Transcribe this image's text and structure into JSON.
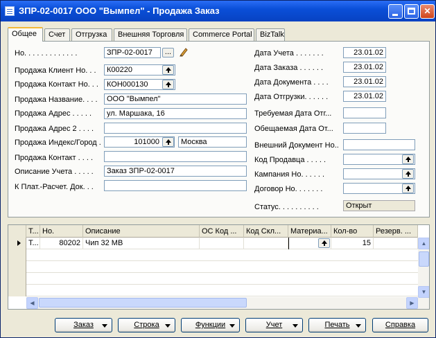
{
  "window": {
    "title": "ЗПР-02-0017 ООО \"Вымпел\" - Продажа Заказ"
  },
  "tabs": [
    "Общее",
    "Счет",
    "Отгрузка",
    "Внешняя Торговля",
    "Commerce Portal",
    "BizTalk"
  ],
  "left": {
    "no_label": "Но. . . . . . . . . . . . .",
    "no_value": "ЗПР-02-0017",
    "no_button": "...",
    "client_label": "Продажа Клиент Но. . .",
    "client_value": "К00220",
    "contact_no_label": "Продажа Контакт Но. . .",
    "contact_no_value": "КОН000130",
    "name_label": "Продажа Название. . . .",
    "name_value": "ООО \"Вымпел\"",
    "address_label": "Продажа Адрес . . . . .",
    "address_value": "ул. Маршака, 16",
    "address2_label": "Продажа Адрес 2 . . . .",
    "address2_value": "",
    "postcode_label": "Продажа Индекс/Город .",
    "postcode_value": "101000",
    "city_value": "Москва",
    "contact_label": "Продажа Контакт . . . .",
    "contact_value": "",
    "posting_desc_label": "Описание Учета . . . . .",
    "posting_desc_value": "Заказ ЗПР-02-0017",
    "payment_label": "К Плат.-Расчет. Док. . .",
    "payment_value": ""
  },
  "right": {
    "posting_date_label": "Дата Учета . . . . . . .",
    "posting_date_value": "23.01.02",
    "order_date_label": "Дата Заказа . . . . . .",
    "order_date_value": "23.01.02",
    "doc_date_label": "Дата Документа . . . .",
    "doc_date_value": "23.01.02",
    "ship_date_label": "Дата Отгрузки. . . . . .",
    "ship_date_value": "23.01.02",
    "req_date_label": "Требуемая Дата Отг...",
    "req_date_value": "",
    "promised_date_label": "Обещаемая Дата От...",
    "promised_date_value": "",
    "ext_doc_label": "Внешний Документ Но..",
    "ext_doc_value": "",
    "salesperson_label": "Код Продавца . . . . .",
    "salesperson_value": "",
    "campaign_label": "Кампания Но. . . . . .",
    "campaign_value": "",
    "contract_label": "Договор Но. . . . . . .",
    "contract_value": "",
    "status_label": "Статус. . . . . . . . . .",
    "status_value": "Открыт"
  },
  "lines": {
    "headers": [
      "Т...",
      "Но.",
      "Описание",
      "ОС Код ...",
      "Код Скл...",
      "Материа...",
      "Кол-во",
      "Резерв. ..."
    ],
    "rows": [
      [
        "Т...",
        "80202",
        "Чип 32 MB",
        "",
        "",
        "",
        "15",
        ""
      ]
    ]
  },
  "buttons": {
    "order": "Заказ",
    "line": "Строка",
    "functions": "Функции",
    "posting": "Учет",
    "print": "Печать",
    "help": "Справка"
  }
}
